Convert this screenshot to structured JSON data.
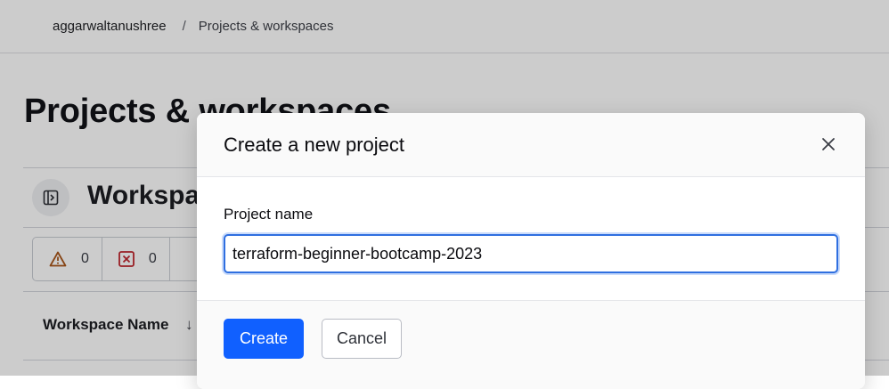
{
  "breadcrumb": {
    "user": "aggarwaltanushree",
    "separator": "/",
    "current": "Projects & workspaces"
  },
  "page": {
    "title": "Projects & workspaces"
  },
  "workspaces_panel": {
    "title": "Workspaces",
    "filters": [
      {
        "icon": "warning-icon",
        "count": "0"
      },
      {
        "icon": "error-icon",
        "count": "0"
      }
    ],
    "table": {
      "columns": [
        {
          "label": "Workspace Name",
          "sort": "↓"
        }
      ]
    }
  },
  "modal": {
    "title": "Create a new project",
    "field": {
      "label": "Project name",
      "value": "terraform-beginner-bootcamp-2023"
    },
    "create_label": "Create",
    "cancel_label": "Cancel"
  },
  "colors": {
    "primary": "#1060ff",
    "focus_ring": "#2f6fe0",
    "warning": "#a8561a",
    "error": "#c0262d"
  }
}
